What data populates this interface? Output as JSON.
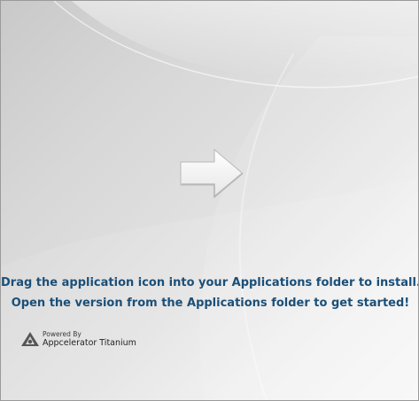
{
  "installer": {
    "instruction_line1": "Drag the application icon into your Applications folder to install.",
    "instruction_line2": "Open the version from the Applications folder to get started!",
    "arrow_icon": "right-arrow-icon"
  },
  "branding": {
    "powered_by": "Powered By",
    "product_name": "Appcelerator Titanium",
    "logo_icon": "appcelerator-logo-icon"
  },
  "colors": {
    "instruction_text": "#1b4f78",
    "border": "#9a9a9a"
  }
}
